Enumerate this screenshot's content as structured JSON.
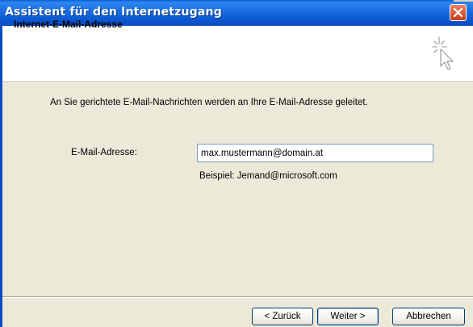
{
  "window": {
    "title": "Assistent für den Internetzugang"
  },
  "header": {
    "title": "Internet-E-Mail-Adresse",
    "icon": "wizard-cursor-icon"
  },
  "content": {
    "intro_text": "An Sie gerichtete E-Mail-Nachrichten werden an Ihre E-Mail-Adresse geleitet.",
    "email_label": "E-Mail-Adresse:",
    "email_value": "max.mustermann@domain.at",
    "example_text": "Beispiel: Jemand@microsoft.com"
  },
  "buttons": {
    "back": "< Zurück",
    "next": "Weiter >",
    "cancel": "Abbrechen"
  },
  "colors": {
    "titlebar": "#0a5fd8",
    "dialog_bg": "#ece9d8",
    "close": "#d9552f"
  }
}
